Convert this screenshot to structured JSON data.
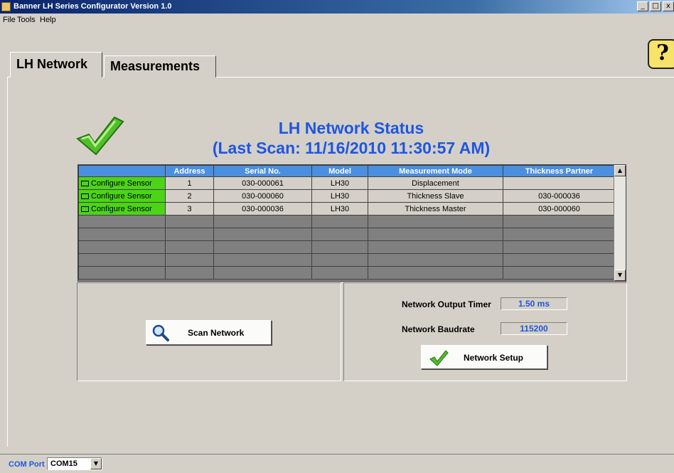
{
  "window": {
    "title": "Banner LH Series Configurator Version 1.0",
    "controls": [
      "_",
      "□",
      "x"
    ]
  },
  "menu": {
    "items": [
      "File",
      "Tools",
      "Help"
    ]
  },
  "tabs": [
    {
      "label": "LH Network",
      "active": true
    },
    {
      "label": "Measurements",
      "active": false
    }
  ],
  "help_icon": {
    "glyph": "?"
  },
  "status": {
    "title": "LH Network Status",
    "last_scan": "(Last Scan: 11/16/2010 11:30:57 AM)",
    "icon": "checkmark-icon"
  },
  "grid": {
    "columns": [
      "",
      "Address",
      "Serial No.",
      "Model",
      "Measurement Mode",
      "Thickness Partner"
    ],
    "rows": [
      {
        "action": "Configure Sensor",
        "address": "1",
        "serial": "030-000061",
        "model": "LH30",
        "mode": "Displacement",
        "partner": ""
      },
      {
        "action": "Configure Sensor",
        "address": "2",
        "serial": "030-000060",
        "model": "LH30",
        "mode": "Thickness Slave",
        "partner": "030-000036"
      },
      {
        "action": "Configure Sensor",
        "address": "3",
        "serial": "030-000036",
        "model": "LH30",
        "mode": "Thickness Master",
        "partner": "030-000060"
      }
    ]
  },
  "scan_panel": {
    "button_label": "Scan Network",
    "icon": "magnifier-icon"
  },
  "network_panel": {
    "output_timer_label": "Network Output Timer",
    "output_timer_value": "1.50 ms",
    "baudrate_label": "Network Baudrate",
    "baudrate_value": "115200",
    "setup_button_label": "Network Setup",
    "setup_icon": "checkmark-icon"
  },
  "statusbar": {
    "com_port_label": "COM Port",
    "com_port_value": "COM15"
  },
  "colors": {
    "accent_blue": "#1f56e0",
    "configure_green": "#4cd417",
    "header_blue": "#4a8fe0"
  }
}
